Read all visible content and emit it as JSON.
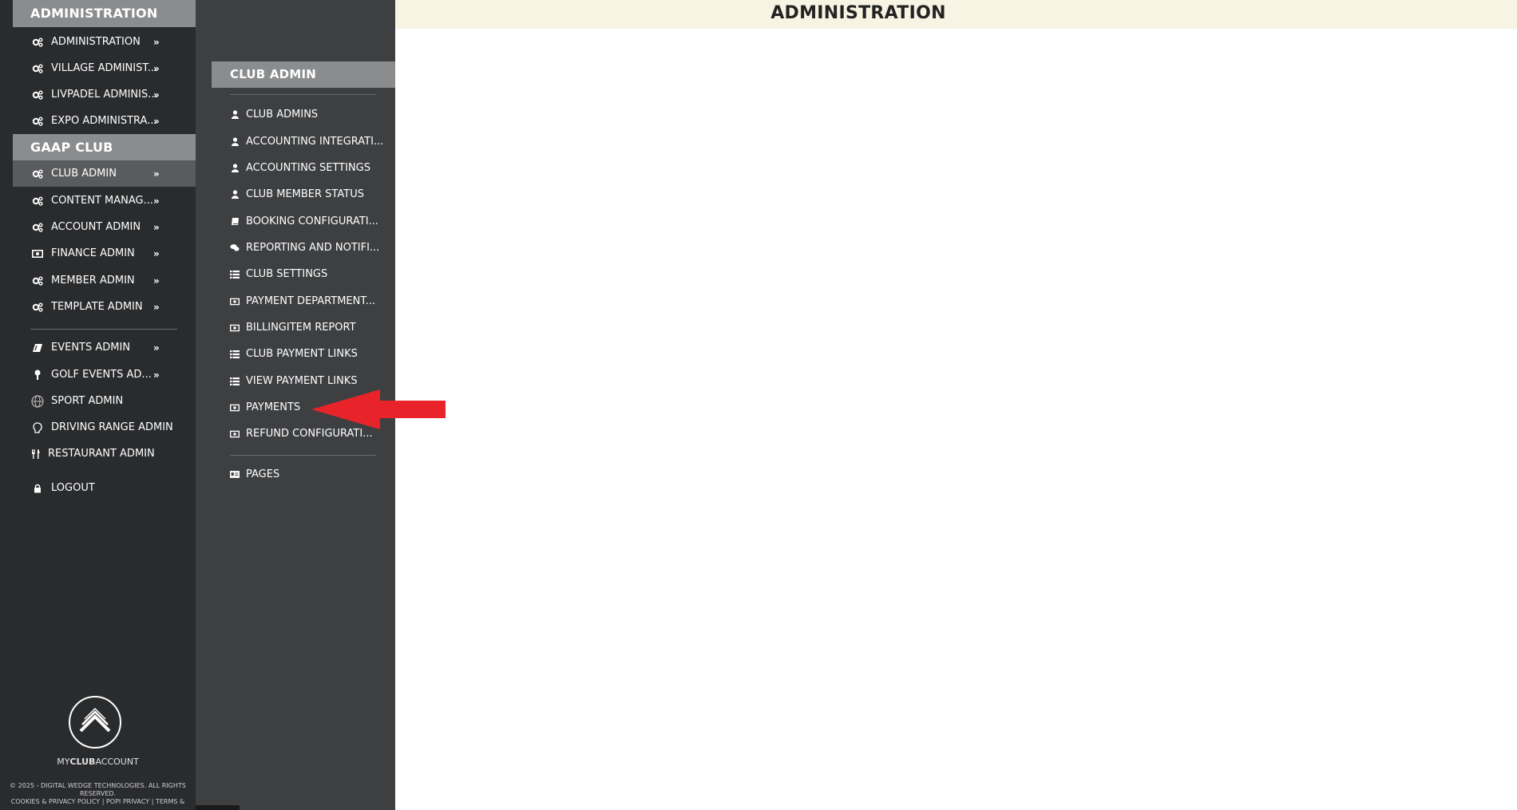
{
  "sidebar": {
    "sections": [
      {
        "title": "ADMINISTRATION"
      },
      {
        "title": "GAAP CLUB"
      }
    ],
    "items": [
      {
        "label": "ADMINISTRATION",
        "icon": "gears-icon",
        "chevron": "»"
      },
      {
        "label": "VILLAGE ADMINIST...",
        "icon": "gears-icon",
        "chevron": "»"
      },
      {
        "label": "LIVPADEL ADMINIS...",
        "icon": "gears-icon",
        "chevron": "»"
      },
      {
        "label": "EXPO ADMINISTRA...",
        "icon": "gears-icon",
        "chevron": "»"
      },
      {
        "label": "CLUB ADMIN",
        "icon": "gears-icon",
        "chevron": "»",
        "active": true
      },
      {
        "label": "CONTENT MANAG...",
        "icon": "gears-icon",
        "chevron": "»"
      },
      {
        "label": "ACCOUNT ADMIN",
        "icon": "gears-icon",
        "chevron": "»"
      },
      {
        "label": "FINANCE ADMIN",
        "icon": "money-icon",
        "chevron": "»"
      },
      {
        "label": "MEMBER ADMIN",
        "icon": "gears-icon",
        "chevron": "»"
      },
      {
        "label": "TEMPLATE ADMIN",
        "icon": "gears-icon",
        "chevron": "»"
      },
      {
        "label": "EVENTS ADMIN",
        "icon": "ticket-icon",
        "chevron": "»"
      },
      {
        "label": "GOLF EVENTS AD...",
        "icon": "golf-tee-icon",
        "chevron": "»"
      },
      {
        "label": "SPORT ADMIN",
        "icon": "globe-icon",
        "chevron": ""
      },
      {
        "label": "DRIVING RANGE ADMIN",
        "icon": "brain-icon",
        "chevron": ""
      },
      {
        "label": "RESTAURANT ADMIN",
        "icon": "cutlery-icon",
        "chevron": ""
      },
      {
        "label": "LOGOUT",
        "icon": "lock-icon",
        "chevron": ""
      }
    ],
    "logo": {
      "pre": "MY",
      "bold": "CLUB",
      "post": "ACCOUNT"
    },
    "footer": [
      "© 2025 - DIGITAL WEDGE TECHNOLOGIES. ALL RIGHTS",
      "RESERVED.",
      "COOKIES & PRIVACY POLICY | POPI PRIVACY | TERMS &"
    ]
  },
  "submenu": {
    "title": "CLUB ADMIN",
    "items": [
      {
        "label": "CLUB ADMINS",
        "icon": "user-icon"
      },
      {
        "label": "ACCOUNTING INTEGRATI...",
        "icon": "user-icon"
      },
      {
        "label": "ACCOUNTING SETTINGS",
        "icon": "user-icon"
      },
      {
        "label": "CLUB MEMBER STATUS",
        "icon": "user-icon"
      },
      {
        "label": "BOOKING CONFIGURATI...",
        "icon": "book-icon"
      },
      {
        "label": "REPORTING AND NOTIFI...",
        "icon": "comments-icon"
      },
      {
        "label": "CLUB SETTINGS",
        "icon": "list-icon"
      },
      {
        "label": "PAYMENT DEPARTMENT...",
        "icon": "money-icon"
      },
      {
        "label": "BILLINGITEM REPORT",
        "icon": "money-icon"
      },
      {
        "label": "CLUB PAYMENT LINKS",
        "icon": "list-icon"
      },
      {
        "label": "VIEW PAYMENT LINKS",
        "icon": "list-icon"
      },
      {
        "label": "PAYMENTS",
        "icon": "money-icon"
      },
      {
        "label": "REFUND CONFIGURATI...",
        "icon": "money-icon"
      },
      {
        "label": "PAGES",
        "icon": "id-card-icon"
      }
    ]
  },
  "header": {
    "title": "ADMINISTRATION"
  },
  "colors": {
    "sidebar_bg": "#2a2b2d",
    "submenu_bg": "#3e3f41",
    "section_header_bg": "#8a8c8e",
    "active_item_bg": "#5a5b5d",
    "topbar_bg": "#f7f4e4",
    "annotation_arrow": "#e8232a"
  }
}
